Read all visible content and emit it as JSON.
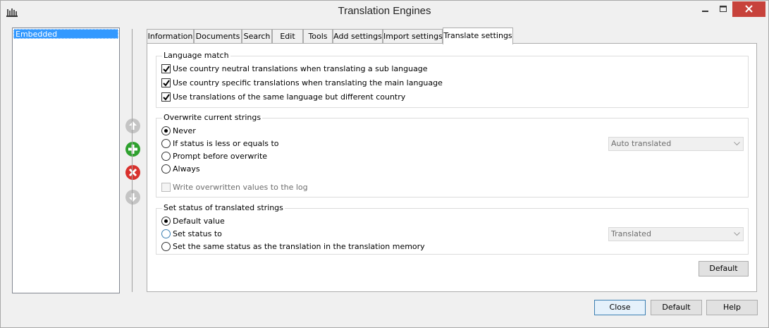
{
  "window": {
    "title": "Translation Engines"
  },
  "engines_list": {
    "items": [
      "Embedded"
    ]
  },
  "tabs": [
    {
      "label": "Information"
    },
    {
      "label": "Documents"
    },
    {
      "label": "Search"
    },
    {
      "label": "Edit"
    },
    {
      "label": "Tools"
    },
    {
      "label": "Add settings"
    },
    {
      "label": "Import settings"
    },
    {
      "label": "Translate settings",
      "active": true
    }
  ],
  "language_match": {
    "title": "Language match",
    "options": [
      {
        "label": "Use country neutral translations when translating a sub language",
        "checked": true
      },
      {
        "label": "Use country specific translations when translating the main language",
        "checked": true
      },
      {
        "label": "Use translations of the same language but different country",
        "checked": true
      }
    ]
  },
  "overwrite": {
    "title": "Overwrite current strings",
    "options": [
      {
        "label": "Never",
        "selected": true
      },
      {
        "label": "If status is less or equals to",
        "selected": false
      },
      {
        "label": "Prompt before overwrite",
        "selected": false
      },
      {
        "label": "Always",
        "selected": false
      }
    ],
    "status_dropdown": "Auto translated",
    "log_label": "Write overwritten values to the log",
    "log_checked": false
  },
  "set_status": {
    "title": "Set status of translated strings",
    "options": [
      {
        "label": "Default value",
        "selected": true
      },
      {
        "label": "Set status to",
        "selected": false
      },
      {
        "label": "Set the same status as the translation in the translation memory",
        "selected": false
      }
    ],
    "status_dropdown": "Translated"
  },
  "panel_default_button": "Default",
  "footer": {
    "close": "Close",
    "default": "Default",
    "help": "Help"
  },
  "colors": {
    "selection": "#3399ff",
    "close_button": "#c7423b",
    "add_icon": "#2fa12f",
    "remove_icon": "#d9312d",
    "disabled_arrow": "#b4b4b4"
  }
}
